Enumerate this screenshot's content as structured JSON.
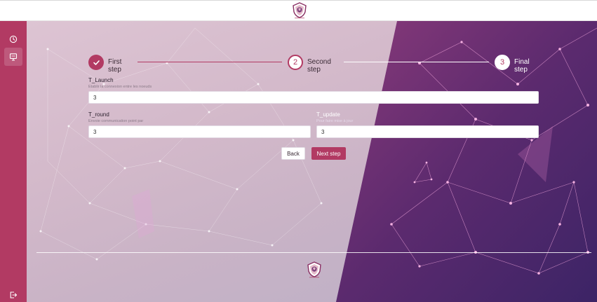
{
  "colors": {
    "brand": "#b23a63",
    "sidebar": "#b23a63",
    "purple": "#5b2a6e"
  },
  "header": {
    "logo_icon": "shield-logo-icon"
  },
  "sidebar": {
    "items": [
      {
        "icon": "clock-icon",
        "label": ""
      },
      {
        "icon": "monitor-icon",
        "label": ""
      }
    ],
    "logout_icon": "logout-icon"
  },
  "stepper": {
    "steps": [
      {
        "number": "",
        "label": "First step",
        "state": "done"
      },
      {
        "number": "2",
        "label": "Second step",
        "state": "current"
      },
      {
        "number": "3",
        "label": "Final step",
        "state": "upcoming"
      }
    ]
  },
  "form": {
    "t_launch": {
      "title": "T_Launch",
      "help": "Etablir la connexion entre les noeuds",
      "value": "3"
    },
    "t_round": {
      "title": "T_round",
      "help": "Envoie communication point par",
      "value": "3"
    },
    "t_update": {
      "title": "T_update",
      "help": "Pour faire mise à jour",
      "value": "3"
    },
    "back_label": "Back",
    "next_label": "Next step"
  },
  "footer": {
    "logo_icon": "shield-logo-icon"
  }
}
